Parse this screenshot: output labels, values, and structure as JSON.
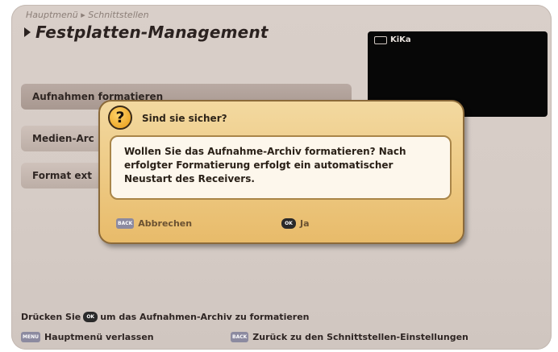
{
  "header": {
    "breadcrumb": "Hauptmenü ▸ Schnittstellen",
    "title": "Festplatten-Management"
  },
  "preview": {
    "channel": "KiKa"
  },
  "menu": {
    "items": [
      {
        "label": "Aufnahmen formatieren"
      },
      {
        "label": "Medien-Arc"
      },
      {
        "label": "Format ext"
      }
    ]
  },
  "dialog": {
    "title": "Sind sie sicher?",
    "message": "Wollen Sie das Aufnahme-Archiv formatieren? Nach erfolgter Formatierung erfolgt ein automatischer Neustart des Receivers.",
    "cancel_key": "BACK",
    "cancel_label": "Abbrechen",
    "ok_key": "OK",
    "ok_label": "Ja"
  },
  "hint": {
    "prefix": "Drücken Sie",
    "key": "OK",
    "suffix": "um das Aufnahmen-Archiv zu formatieren"
  },
  "footer": {
    "left_key": "MENU",
    "left_label": "Hauptmenü verlassen",
    "right_key": "BACK",
    "right_label": "Zurück zu den Schnittstellen-Einstellungen"
  },
  "colors": {
    "background": "#d6ccc6",
    "dialog": "#e8bb6a",
    "dialog_border": "#8b6a3a",
    "preview": "#070707"
  },
  "icons": [
    "question-icon",
    "title-arrow-icon",
    "tv-icon"
  ]
}
